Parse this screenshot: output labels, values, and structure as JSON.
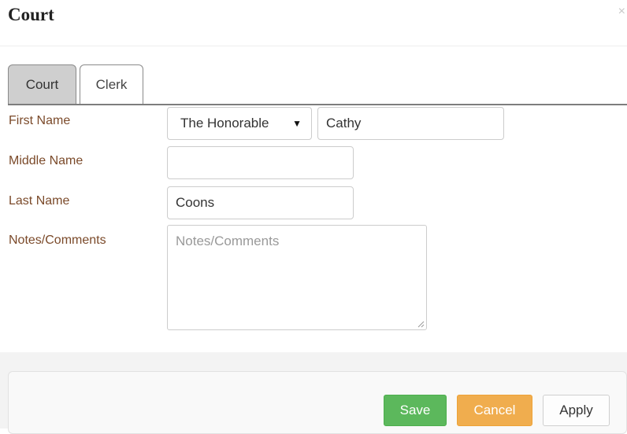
{
  "dialog": {
    "title": "Court",
    "close_glyph": "×"
  },
  "tabs": [
    {
      "label": "Court",
      "active": true
    },
    {
      "label": "Clerk",
      "active": false
    }
  ],
  "form": {
    "first_name": {
      "label": "First Name",
      "title_selected": "The Honorable",
      "value": "Cathy"
    },
    "middle_name": {
      "label": "Middle Name",
      "value": ""
    },
    "last_name": {
      "label": "Last Name",
      "value": "Coons"
    },
    "notes": {
      "label": "Notes/Comments",
      "placeholder": "Notes/Comments",
      "value": ""
    }
  },
  "buttons": {
    "save": "Save",
    "cancel": "Cancel",
    "apply": "Apply"
  },
  "colors": {
    "label": "#7b4a2a",
    "save": "#5cb85c",
    "cancel": "#f0ad4e"
  }
}
